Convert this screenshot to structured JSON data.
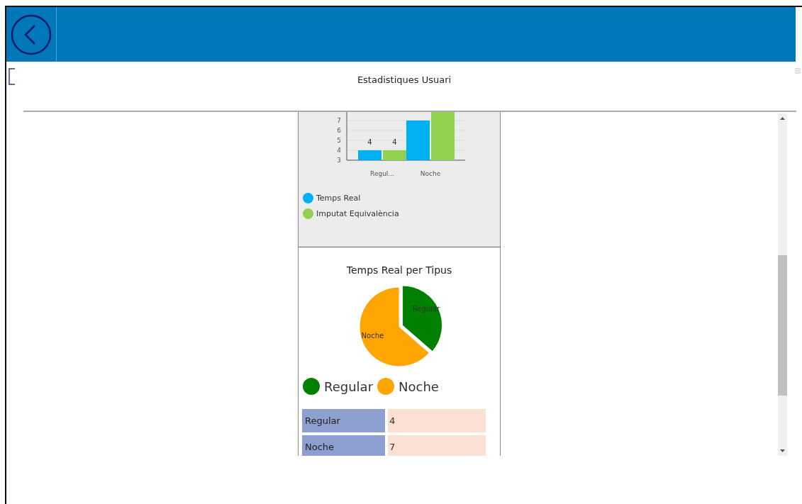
{
  "page": {
    "title": "Estadistiques Usuari"
  },
  "bar_chart": {
    "chart_data": {
      "type": "bar",
      "categories": [
        "Regul...",
        "Noche"
      ],
      "yticks": [
        3,
        4,
        5,
        6,
        7
      ],
      "ylim": [
        3,
        8
      ],
      "grid": true,
      "value_labels": [
        [
          "4",
          null
        ],
        [
          "4",
          null
        ]
      ],
      "series": [
        {
          "name": "Temps Real",
          "color": "#00b0f0",
          "values": [
            4,
            7
          ]
        },
        {
          "name": "Imputat Equivalència",
          "color": "#92d050",
          "values": [
            4,
            8
          ]
        }
      ]
    }
  },
  "pie_chart": {
    "title": "Temps Real per Tipus",
    "chart_data": {
      "type": "pie",
      "categories": [
        "Regular",
        "Noche"
      ],
      "series": [
        {
          "values": [
            36.4,
            63.6
          ]
        }
      ],
      "colors": [
        "#008000",
        "#ffa500"
      ]
    },
    "legend": [
      {
        "label": "Regular",
        "color": "#008000"
      },
      {
        "label": "Noche",
        "color": "#ffa500"
      }
    ]
  },
  "table": {
    "rows": [
      {
        "label": "Regular",
        "value": "4"
      },
      {
        "label": "Noche",
        "value": "7"
      }
    ]
  }
}
